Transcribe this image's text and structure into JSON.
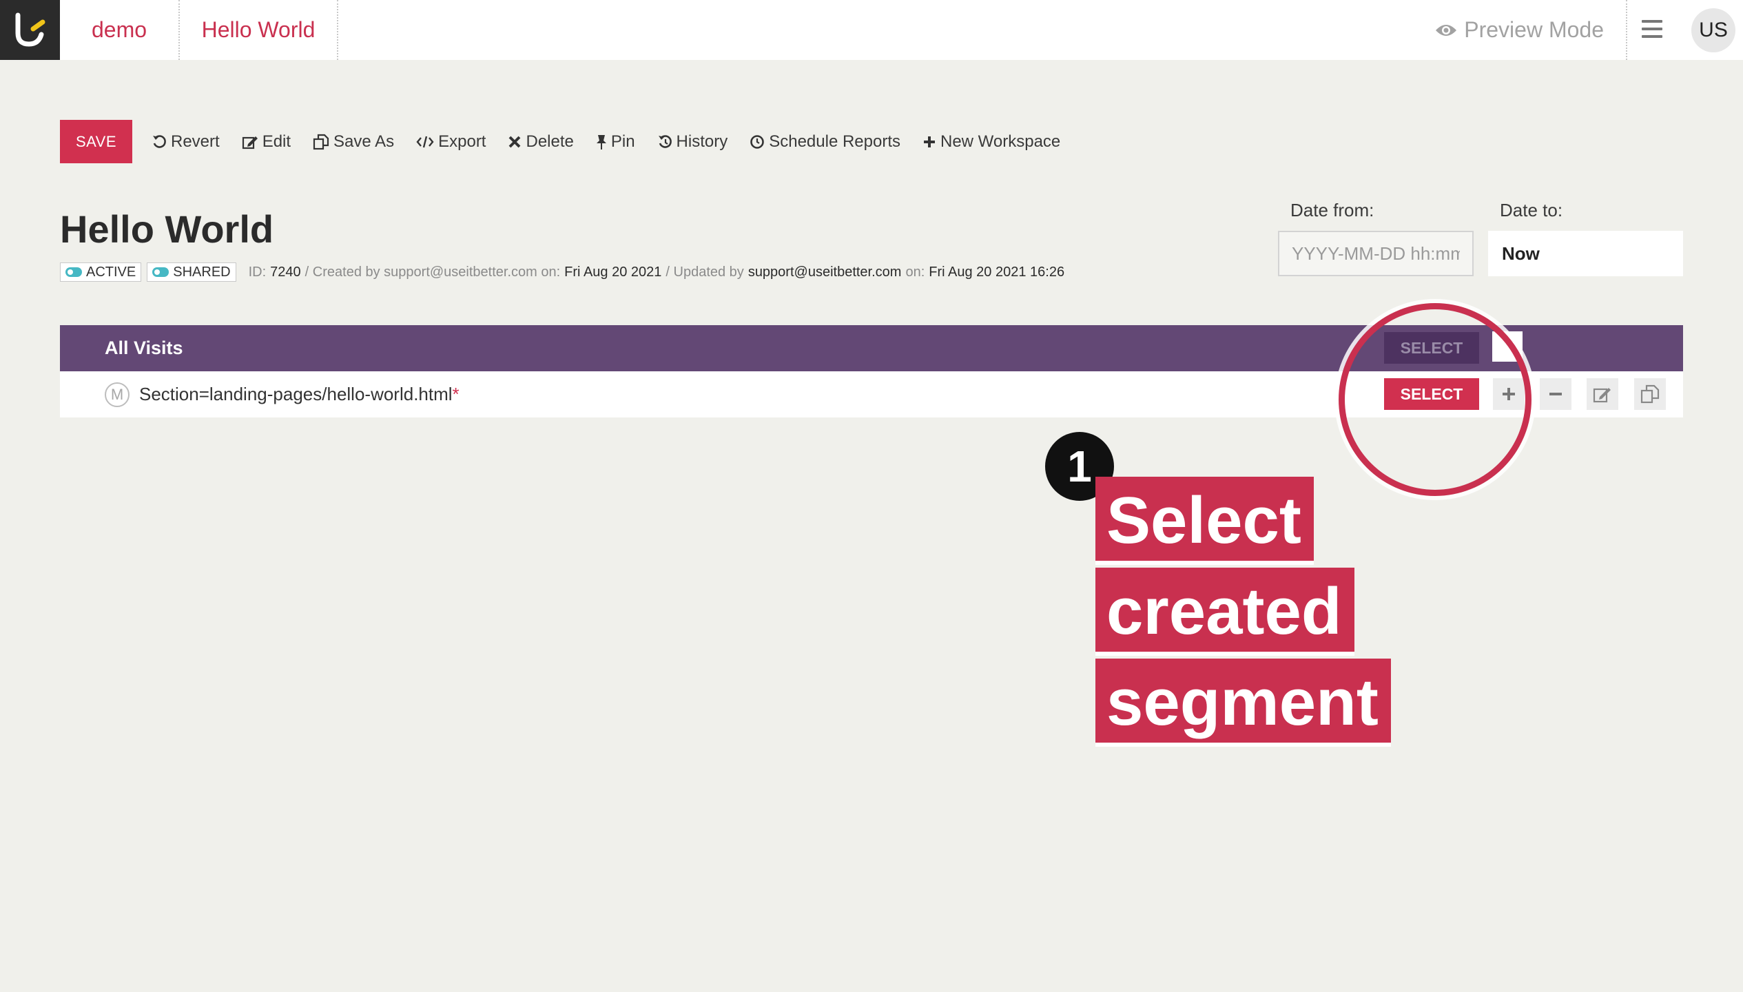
{
  "header": {
    "workspace": "demo",
    "page": "Hello World",
    "preview_label": "Preview Mode",
    "user_initials": "US"
  },
  "toolbar": {
    "save_label": "SAVE",
    "revert_label": "Revert",
    "edit_label": "Edit",
    "save_as_label": "Save As",
    "export_label": "Export",
    "delete_label": "Delete",
    "pin_label": "Pin",
    "history_label": "History",
    "schedule_label": "Schedule Reports",
    "new_workspace_label": "New Workspace"
  },
  "page": {
    "title": "Hello World",
    "badge_active": "ACTIVE",
    "badge_shared": "SHARED",
    "id_label": "ID:",
    "id_value": "7240",
    "created_by_label": "/ Created by support@useitbetter.com on:",
    "created_on": "Fri Aug 20 2021",
    "updated_by_label": "/ Updated by",
    "updated_by": "support@useitbetter.com",
    "on_label": "on:",
    "updated_on": "Fri Aug 20 2021 16:26"
  },
  "dates": {
    "from_label": "Date from:",
    "from_placeholder": "YYYY-MM-DD hh:mm",
    "to_label": "Date to:",
    "to_value": "Now"
  },
  "segments": {
    "header_title": "All Visits",
    "header_select_label": "SELECT",
    "row": {
      "marker": "M",
      "name": "Section=landing-pages/hello-world.html",
      "required_mark": "*",
      "select_label": "SELECT"
    }
  },
  "annotation": {
    "step": "1",
    "lines": [
      "Select",
      "created",
      "segment"
    ],
    "accent_color": "#c9304f"
  },
  "icons": [
    "logo-icon",
    "eye-icon",
    "hamburger-icon",
    "revert-icon",
    "edit-icon",
    "save-as-icon",
    "code-icon",
    "delete-icon",
    "pin-icon",
    "history-icon",
    "clock-icon",
    "plus-icon",
    "minus-icon",
    "copy-icon"
  ]
}
